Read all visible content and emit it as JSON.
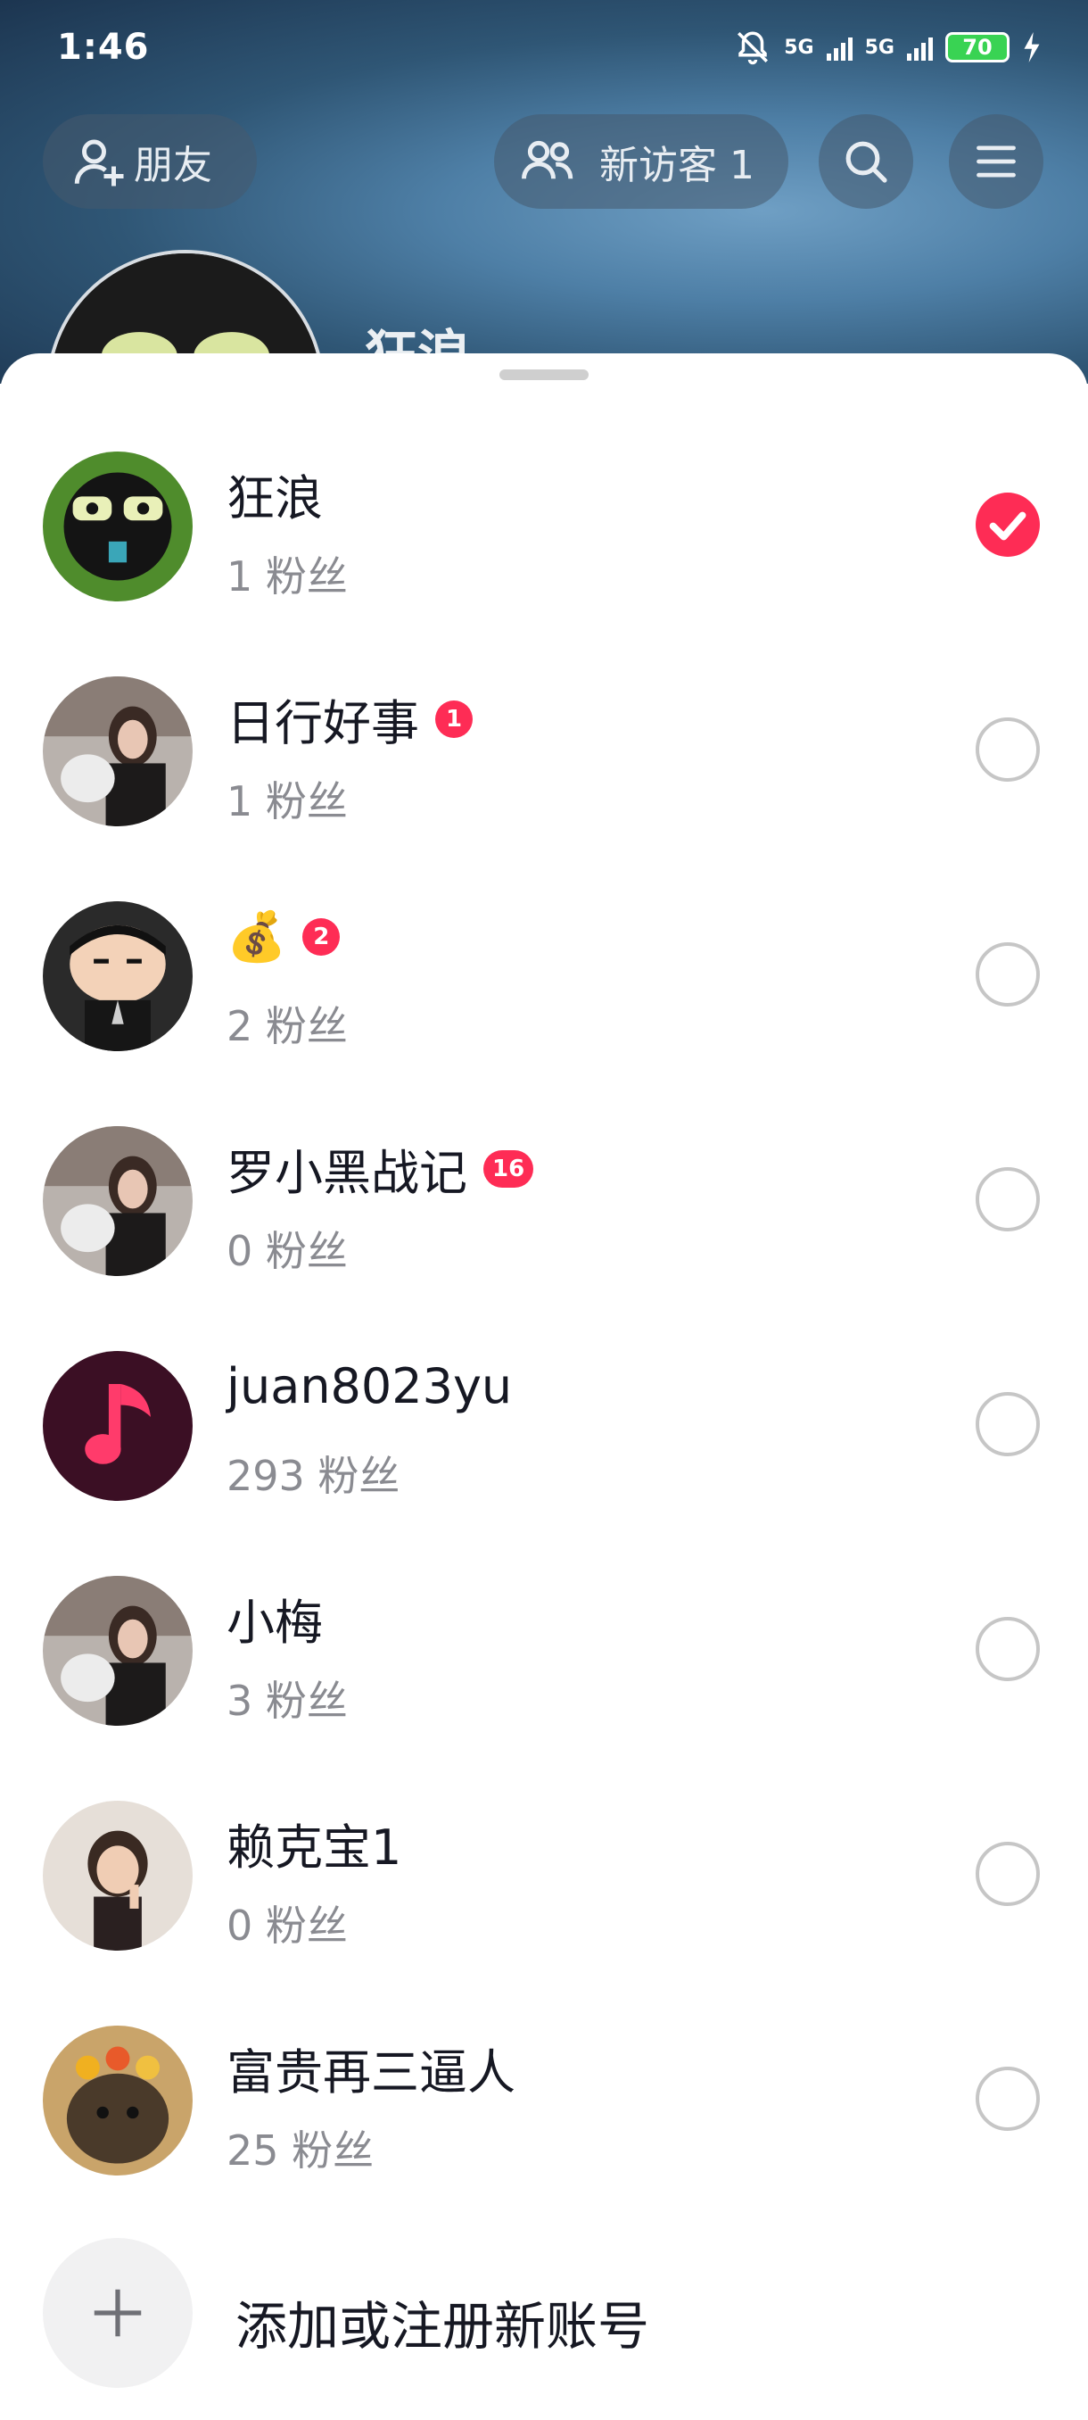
{
  "status_bar": {
    "time": "1:46",
    "network_1": "5G",
    "network_2": "5G",
    "battery": "70"
  },
  "header": {
    "friends_label": "朋友",
    "visitors_label": "新访客 1",
    "profile_name_peek": "狂浪"
  },
  "accounts": [
    {
      "name": "狂浪",
      "fans": "1 粉丝",
      "badge": "",
      "selected": true
    },
    {
      "name": "日行好事",
      "fans": "1 粉丝",
      "badge": "1",
      "selected": false
    },
    {
      "name": "💰",
      "fans": "2 粉丝",
      "badge": "2",
      "selected": false
    },
    {
      "name": "罗小黑战记",
      "fans": "0 粉丝",
      "badge": "16",
      "selected": false
    },
    {
      "name": "juan8023yu",
      "fans": "293 粉丝",
      "badge": "",
      "selected": false
    },
    {
      "name": "小梅",
      "fans": "3 粉丝",
      "badge": "",
      "selected": false
    },
    {
      "name": "赖克宝1",
      "fans": "0 粉丝",
      "badge": "",
      "selected": false
    },
    {
      "name": "富贵再三逼人",
      "fans": "25 粉丝",
      "badge": "",
      "selected": false
    }
  ],
  "add_account_label": "添加或注册新账号",
  "colors": {
    "accent": "#fe2c55",
    "text_primary": "#161823",
    "text_secondary": "#8a8b91"
  }
}
